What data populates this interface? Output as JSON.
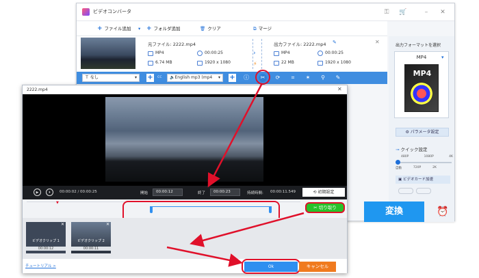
{
  "app": {
    "title": "ビデオコンバータ"
  },
  "toolbar": {
    "add_file": "ファイル追加",
    "add_folder": "フォルダ追加",
    "clear": "クリア",
    "merge": "マージ"
  },
  "source": {
    "filename_label": "元ファイル: 2222.mp4",
    "format": "MP4",
    "duration": "00:00:25",
    "size": "6.74 MB",
    "resolution": "1920 x 1080"
  },
  "output": {
    "filename_label": "出力ファイル: 2222.mp4",
    "format": "MP4",
    "duration": "00:00:25",
    "size": "22 MB",
    "resolution": "1920 x 1080"
  },
  "bluebar": {
    "subtitle": "なし",
    "audio": "English mp3 (mp4"
  },
  "panel": {
    "heading": "出力フォーマットを選択",
    "format": "MP4",
    "card_label": "MP4",
    "param_button": "パラメータ設定",
    "quick_setting": "クイック設定",
    "ticks": [
      "480P",
      "1080P",
      "4K"
    ],
    "ticks2": [
      "自動",
      "720P",
      "2K"
    ],
    "gpu": "ビデオカード加速",
    "convert": "変換"
  },
  "dialog": {
    "title": "2222.mp4",
    "current_time": "00:00:02 / 00:00:25",
    "start_label": "開始",
    "start_value": "00:00:12",
    "end_label": "終了",
    "end_value": "00:00:23",
    "duration_label": "持続時間:",
    "duration_value": "00:00:11.549",
    "reset": "初期設定",
    "cut": "切り取り",
    "clips": [
      {
        "name": "ビデオクリップ 1",
        "time": "00:00:12"
      },
      {
        "name": "ビデオクリップ 2",
        "time": "00:00:11"
      }
    ],
    "tutorial": "チュートリアル >",
    "ok": "Ok",
    "cancel": "キャンセル"
  },
  "colors": {
    "accent": "#1f97f0",
    "cancel": "#f07a1e",
    "annotation": "#e0102a",
    "cut_border": "#27c22a"
  }
}
